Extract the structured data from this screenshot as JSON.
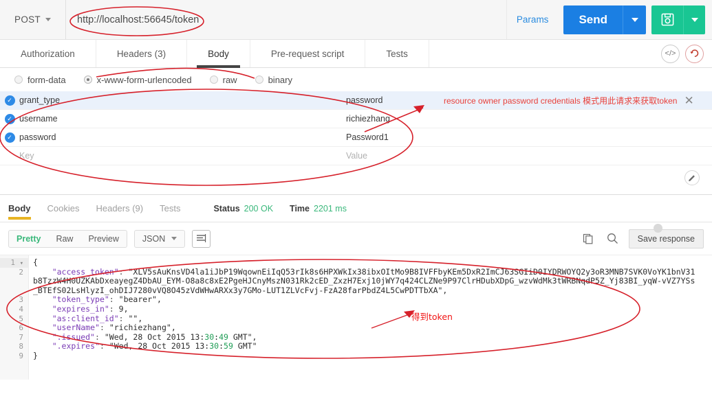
{
  "request": {
    "method": "POST",
    "url": "http://localhost:56645/token",
    "params_label": "Params",
    "send_label": "Send",
    "save_icon": "floppy-disk-icon",
    "tabs": [
      {
        "label": "Authorization",
        "active": false
      },
      {
        "label": "Headers (3)",
        "active": false
      },
      {
        "label": "Body",
        "active": true
      },
      {
        "label": "Pre-request script",
        "active": false
      },
      {
        "label": "Tests",
        "active": false
      }
    ],
    "tab_icons": [
      {
        "name": "code-icon",
        "glyph": "</>"
      },
      {
        "name": "reset-icon",
        "glyph": "↺"
      }
    ],
    "body_types": [
      {
        "label": "form-data",
        "selected": false
      },
      {
        "label": "x-www-form-urlencoded",
        "selected": true
      },
      {
        "label": "raw",
        "selected": false
      },
      {
        "label": "binary",
        "selected": false
      }
    ],
    "kv_headers": {
      "key": "Key",
      "value": "Value"
    },
    "kv_rows": [
      {
        "checked": true,
        "key": "grant_type",
        "value": "password",
        "highlight": true
      },
      {
        "checked": true,
        "key": "username",
        "value": "richiezhang",
        "highlight": false
      },
      {
        "checked": true,
        "key": "password",
        "value": "Password1",
        "highlight": false
      }
    ],
    "kv_empty_row": {
      "key_placeholder": "Key",
      "value_placeholder": "Value"
    },
    "row_note": "resource owner password credentials 模式用此请求来获取token",
    "row_note_close": "✕",
    "pencil_icon": "edit-pencil-icon"
  },
  "response": {
    "tabs": [
      {
        "label": "Body",
        "active": true
      },
      {
        "label": "Cookies",
        "active": false
      },
      {
        "label": "Headers (9)",
        "active": false
      },
      {
        "label": "Tests",
        "active": false
      }
    ],
    "status_label": "Status",
    "status_value": "200 OK",
    "time_label": "Time",
    "time_value": "2201 ms",
    "view_modes": [
      {
        "label": "Pretty",
        "active": true
      },
      {
        "label": "Raw",
        "active": false
      },
      {
        "label": "Preview",
        "active": false
      }
    ],
    "format": "JSON",
    "wrap_icon": "wrap-lines-icon",
    "copy_icon": "copy-icon",
    "search_icon": "search-icon",
    "save_response_label": "Save response",
    "code_lines": [
      {
        "n": "1",
        "fold": true,
        "text": "{"
      },
      {
        "n": "2",
        "fold": false,
        "text": "    \"access_token\": \"XLV5sAuKnsVD4la1iJbP19WqownEiIqQ53rIk8s6HPXWkIx38ibxOItMo9B8IVFFbyKEm5DxR2ImCJ63SGIiD0IYDRWOYQ2y3oR3MNB7SVK0VoYK1bnV31b8TzzW4H0UZKAbDxeayegZ4DbAU_EYM-O8a8c8xE2PgeHJCnyMszN031Rk2cED_ZxzH7Exj10jWY7q424CLZNe9P97ClrHDubXDpG_wzvWdMk3tWRBNqdP5Z_Yj83BI_yqW-vVZ7YSs_BTEfS02LsHlyzI_ohDIJ7280vVQ8O45zVdWHwARXx3y7GMo-LUT1ZLVcFvj-FzA28farPbdZ4L5CwPDTTbXA\","
      },
      {
        "n": "3",
        "fold": false,
        "text": "    \"token_type\": \"bearer\","
      },
      {
        "n": "4",
        "fold": false,
        "text": "    \"expires_in\": 9,"
      },
      {
        "n": "5",
        "fold": false,
        "text": "    \"as:client_id\": \"\","
      },
      {
        "n": "6",
        "fold": false,
        "text": "    \"userName\": \"richiezhang\","
      },
      {
        "n": "7",
        "fold": false,
        "text": "    \".issued\": \"Wed, 28 Oct 2015 13:30:49 GMT\","
      },
      {
        "n": "8",
        "fold": false,
        "text": "    \".expires\": \"Wed, 28 Oct 2015 13:30:59 GMT\""
      },
      {
        "n": "9",
        "fold": false,
        "text": "}"
      }
    ]
  },
  "annotations": {
    "url_ellipse": "url-highlight-ellipse",
    "body_tab_arc": "body-tab-arc",
    "kv_ellipse": "kv-rows-ellipse",
    "note_arrow": "note-arrow",
    "token_note": "得到token",
    "token_ellipse": "token-ellipse",
    "color": "#d6202a"
  }
}
